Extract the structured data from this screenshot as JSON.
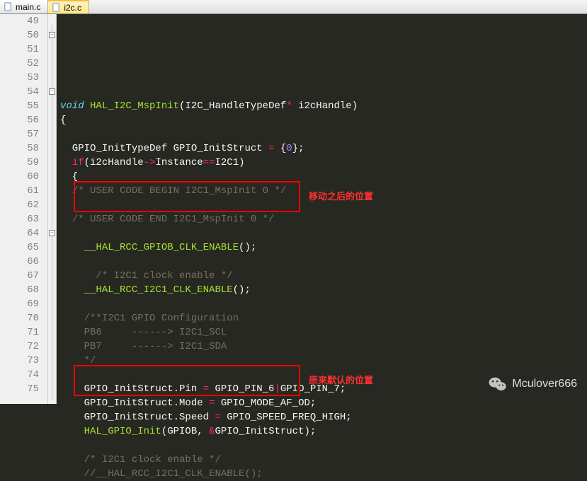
{
  "tabs": [
    {
      "label": "main.c",
      "active": false
    },
    {
      "label": "i2c.c",
      "active": true
    }
  ],
  "lines": [
    {
      "n": 49,
      "tokens": [
        [
          "kw",
          "void"
        ],
        [
          "txt",
          " "
        ],
        [
          "fn",
          "HAL_I2C_MspInit"
        ],
        [
          "txt",
          "("
        ],
        [
          "txt",
          "I2C_HandleTypeDef"
        ],
        [
          "op",
          "*"
        ],
        [
          "txt",
          " i2cHandle"
        ],
        [
          "txt",
          ")"
        ]
      ]
    },
    {
      "n": 50,
      "fold": "minus",
      "tokens": [
        [
          "txt",
          "{"
        ]
      ]
    },
    {
      "n": 51,
      "tokens": []
    },
    {
      "n": 52,
      "tokens": [
        [
          "txt",
          "  GPIO_InitTypeDef GPIO_InitStruct "
        ],
        [
          "op",
          "="
        ],
        [
          "txt",
          " {"
        ],
        [
          "num",
          "0"
        ],
        [
          "txt",
          "};"
        ]
      ]
    },
    {
      "n": 53,
      "tokens": [
        [
          "txt",
          "  "
        ],
        [
          "kw2",
          "if"
        ],
        [
          "txt",
          "(i2cHandle"
        ],
        [
          "op",
          "->"
        ],
        [
          "txt",
          "Instance"
        ],
        [
          "op",
          "=="
        ],
        [
          "txt",
          "I2C1)"
        ]
      ]
    },
    {
      "n": 54,
      "fold": "minus",
      "tokens": [
        [
          "txt",
          "  {"
        ]
      ]
    },
    {
      "n": 55,
      "tokens": [
        [
          "txt",
          "  "
        ],
        [
          "cmt",
          "/* USER CODE BEGIN I2C1_MspInit 0 */"
        ]
      ]
    },
    {
      "n": 56,
      "tokens": []
    },
    {
      "n": 57,
      "tokens": [
        [
          "txt",
          "  "
        ],
        [
          "cmt",
          "/* USER CODE END I2C1_MspInit 0 */"
        ]
      ]
    },
    {
      "n": 58,
      "tokens": []
    },
    {
      "n": 59,
      "tokens": [
        [
          "txt",
          "    "
        ],
        [
          "fn",
          "__HAL_RCC_GPIOB_CLK_ENABLE"
        ],
        [
          "txt",
          "();"
        ]
      ]
    },
    {
      "n": 60,
      "tokens": []
    },
    {
      "n": 61,
      "tokens": [
        [
          "txt",
          "      "
        ],
        [
          "cmt",
          "/* I2C1 clock enable */"
        ]
      ]
    },
    {
      "n": 62,
      "tokens": [
        [
          "txt",
          "    "
        ],
        [
          "fn",
          "__HAL_RCC_I2C1_CLK_ENABLE"
        ],
        [
          "txt",
          "();"
        ]
      ]
    },
    {
      "n": 63,
      "tokens": []
    },
    {
      "n": 64,
      "fold": "minus",
      "tokens": [
        [
          "txt",
          "    "
        ],
        [
          "cmt",
          "/**I2C1 GPIO Configuration"
        ]
      ]
    },
    {
      "n": 65,
      "tokens": [
        [
          "txt",
          "    "
        ],
        [
          "cmt",
          "PB6     ------> I2C1_SCL"
        ]
      ]
    },
    {
      "n": 66,
      "tokens": [
        [
          "txt",
          "    "
        ],
        [
          "cmt",
          "PB7     ------> I2C1_SDA"
        ]
      ]
    },
    {
      "n": 67,
      "tokens": [
        [
          "txt",
          "    "
        ],
        [
          "cmt",
          "*/"
        ]
      ]
    },
    {
      "n": 68,
      "tokens": []
    },
    {
      "n": 69,
      "tokens": [
        [
          "txt",
          "    GPIO_InitStruct.Pin "
        ],
        [
          "op",
          "="
        ],
        [
          "txt",
          " GPIO_PIN_6"
        ],
        [
          "op",
          "|"
        ],
        [
          "txt",
          "GPIO_PIN_7;"
        ]
      ]
    },
    {
      "n": 70,
      "tokens": [
        [
          "txt",
          "    GPIO_InitStruct.Mode "
        ],
        [
          "op",
          "="
        ],
        [
          "txt",
          " GPIO_MODE_AF_OD;"
        ]
      ]
    },
    {
      "n": 71,
      "tokens": [
        [
          "txt",
          "    GPIO_InitStruct.Speed "
        ],
        [
          "op",
          "="
        ],
        [
          "txt",
          " GPIO_SPEED_FREQ_HIGH;"
        ]
      ]
    },
    {
      "n": 72,
      "tokens": [
        [
          "txt",
          "    "
        ],
        [
          "fn",
          "HAL_GPIO_Init"
        ],
        [
          "txt",
          "(GPIOB, "
        ],
        [
          "op",
          "&"
        ],
        [
          "txt",
          "GPIO_InitStruct);"
        ]
      ]
    },
    {
      "n": 73,
      "tokens": []
    },
    {
      "n": 74,
      "tokens": [
        [
          "txt",
          "    "
        ],
        [
          "cmt",
          "/* I2C1 clock enable */"
        ]
      ]
    },
    {
      "n": 75,
      "tokens": [
        [
          "txt",
          "    "
        ],
        [
          "cmt",
          "//__HAL_RCC_I2C1_CLK_ENABLE();"
        ]
      ]
    }
  ],
  "annotations": {
    "box1": {
      "label": "移动之后的位置"
    },
    "box2": {
      "label": "原来默认的位置"
    }
  },
  "watermark": "Mculover666"
}
